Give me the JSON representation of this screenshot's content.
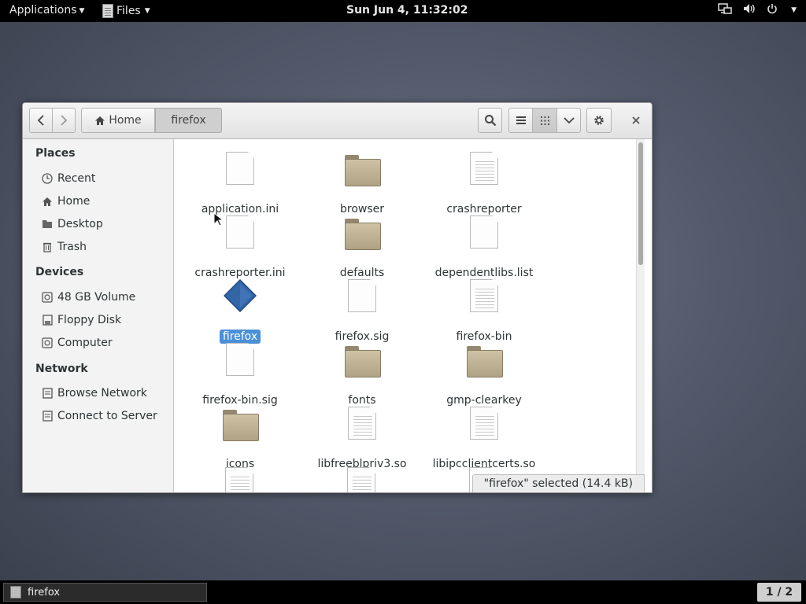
{
  "topbar": {
    "applications": "Applications",
    "files_menu": "Files",
    "clock": "Sun Jun  4, 11:32:02"
  },
  "window": {
    "breadcrumb": {
      "home": "Home",
      "current": "firefox"
    },
    "sidebar": {
      "places_title": "Places",
      "places": [
        {
          "label": "Recent",
          "icon": "clock-icon"
        },
        {
          "label": "Home",
          "icon": "home-icon"
        },
        {
          "label": "Desktop",
          "icon": "folder-icon"
        },
        {
          "label": "Trash",
          "icon": "trash-icon"
        }
      ],
      "devices_title": "Devices",
      "devices": [
        {
          "label": "48 GB Volume",
          "icon": "drive-icon"
        },
        {
          "label": "Floppy Disk",
          "icon": "floppy-icon"
        },
        {
          "label": "Computer",
          "icon": "drive-icon"
        }
      ],
      "network_title": "Network",
      "network": [
        {
          "label": "Browse Network",
          "icon": "network-icon"
        },
        {
          "label": "Connect to Server",
          "icon": "server-icon"
        }
      ]
    },
    "files": [
      {
        "name": "application.ini",
        "type": "doc"
      },
      {
        "name": "browser",
        "type": "folder"
      },
      {
        "name": "crashreporter",
        "type": "doc-lines"
      },
      {
        "name": "crashreporter.ini",
        "type": "doc"
      },
      {
        "name": "defaults",
        "type": "folder"
      },
      {
        "name": "dependentlibs.list",
        "type": "doc"
      },
      {
        "name": "firefox",
        "type": "exec",
        "selected": true
      },
      {
        "name": "firefox.sig",
        "type": "doc"
      },
      {
        "name": "firefox-bin",
        "type": "doc-lines"
      },
      {
        "name": "firefox-bin.sig",
        "type": "doc"
      },
      {
        "name": "fonts",
        "type": "folder"
      },
      {
        "name": "gmp-clearkey",
        "type": "folder"
      },
      {
        "name": "icons",
        "type": "folder"
      },
      {
        "name": "libfreeblpriv3.so",
        "type": "doc-lines"
      },
      {
        "name": "libipcclientcerts.so",
        "type": "doc-lines"
      }
    ],
    "status": "\"firefox\" selected  (14.4 kB)"
  },
  "taskbar": {
    "task": "firefox",
    "pager": "1 / 2"
  },
  "colors": {
    "selection": "#4a90d9",
    "folder": "#b0a283"
  }
}
